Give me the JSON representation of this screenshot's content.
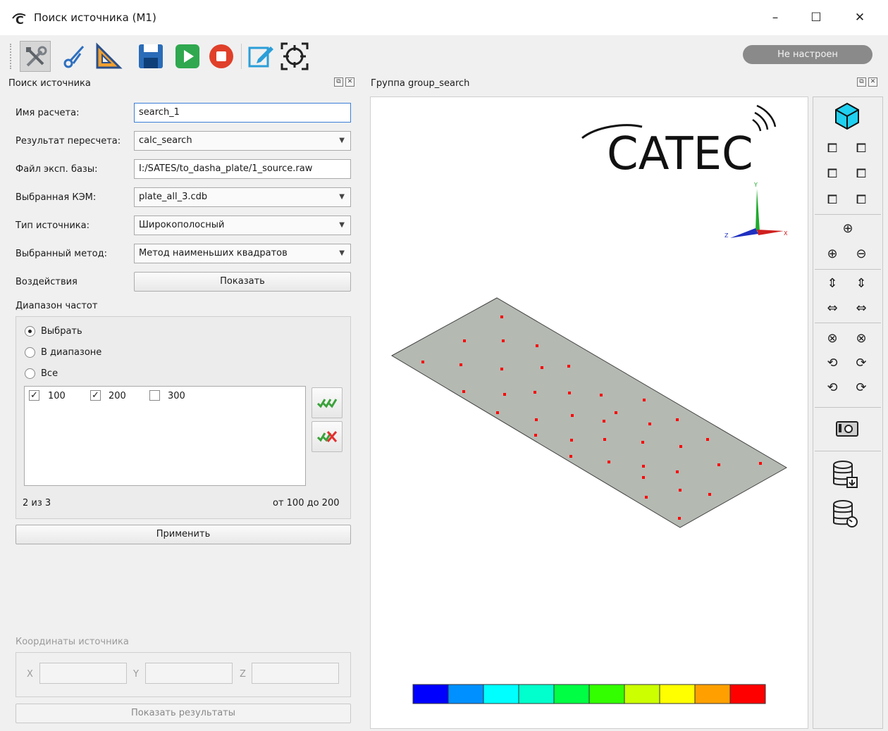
{
  "window": {
    "title": "Поиск источника (M1)",
    "app_icon": "catec-logo-icon",
    "controls": {
      "minimize": "–",
      "maximize": "☐",
      "close": "✕"
    }
  },
  "toolbar": {
    "buttons": [
      {
        "name": "settings-tools-icon"
      },
      {
        "name": "cut-tools-icon"
      },
      {
        "name": "ruler-triangle-icon"
      },
      {
        "name": "save-icon"
      },
      {
        "name": "play-icon"
      },
      {
        "name": "stop-icon"
      },
      {
        "name": "edit-icon"
      },
      {
        "name": "target-select-icon"
      }
    ],
    "status": "Не настроен"
  },
  "left_panel": {
    "title": "Поиск источника",
    "fields": {
      "calc_name_label": "Имя расчета:",
      "calc_name_value": "search_1",
      "recalc_result_label": "Результат пересчета:",
      "recalc_result_value": "calc_search",
      "exp_base_label": "Файл эксп. базы:",
      "exp_base_value": "I:/SATES/to_dasha_plate/1_source.raw",
      "fem_label": "Выбранная КЭМ:",
      "fem_value": "plate_all_3.cdb",
      "source_type_label": "Тип источника:",
      "source_type_value": "Широкополосный",
      "method_label": "Выбранный метод:",
      "method_value": "Метод наименьших квадратов",
      "impacts_label": "Воздействия",
      "impacts_button": "Показать"
    },
    "freq_range": {
      "title": "Диапазон частот",
      "options": [
        "Выбрать",
        "В диапазоне",
        "Все"
      ],
      "selected": "Выбрать",
      "items": [
        {
          "label": "100",
          "checked": true,
          "mark": "✓"
        },
        {
          "label": "200",
          "checked": true,
          "mark": "✓"
        },
        {
          "label": "300",
          "checked": false,
          "mark": ""
        }
      ],
      "count": "2 из 3",
      "range": "от 100 до 200",
      "apply": "Применить"
    },
    "coords": {
      "title": "Координаты источника",
      "x_label": "X",
      "y_label": "Y",
      "z_label": "Z",
      "show_results": "Показать результаты"
    }
  },
  "viewport": {
    "title": "Группа group_search",
    "logo_text": "CATEC",
    "axes": {
      "x": "X",
      "y": "Y",
      "z": "Z"
    },
    "plate_color": "#b4b9b2",
    "point_color": "#ff0000",
    "colorbar": [
      "#0000ff",
      "#0090ff",
      "#00ffff",
      "#00ffcc",
      "#00ff44",
      "#33ff00",
      "#ccff00",
      "#ffff00",
      "#ffa000",
      "#ff0000"
    ]
  },
  "view_toolbar": {
    "groups": [
      [
        "iso-view-icon",
        "front-view-icon",
        "back-view-icon",
        "left-view-icon",
        "right-view-icon",
        "top-view-icon",
        "bottom-view-icon"
      ],
      [
        "zoom-fit-icon",
        "zoom-in-icon",
        "zoom-out-icon"
      ],
      [
        "pan-down-icon",
        "pan-up-icon",
        "pan-left-icon",
        "pan-right-icon"
      ],
      [
        "rotate-x-neg-icon",
        "rotate-x-pos-icon",
        "rotate-y-neg-icon",
        "rotate-y-pos-icon",
        "rotate-z-neg-icon",
        "rotate-z-pos-icon"
      ],
      [
        "screenshot-icon"
      ],
      [
        "db-export-icon",
        "db-refresh-icon"
      ]
    ]
  }
}
